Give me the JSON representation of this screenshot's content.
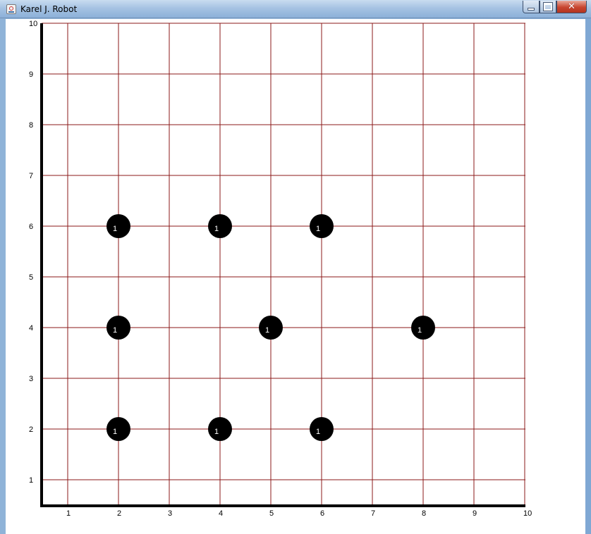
{
  "window": {
    "title": "Karel J. Robot",
    "controls": {
      "minimize": "minimize",
      "maximize": "maximize",
      "close": "close"
    }
  },
  "world": {
    "streets": 10,
    "avenues": 10,
    "x_labels": [
      "1",
      "2",
      "3",
      "4",
      "5",
      "6",
      "7",
      "8",
      "9",
      "10"
    ],
    "y_labels": [
      "1",
      "2",
      "3",
      "4",
      "5",
      "6",
      "7",
      "8",
      "9",
      "10"
    ],
    "grid_color": "#8b1a1a",
    "wall_color": "#000000",
    "beepers": [
      {
        "avenue": 2,
        "street": 6,
        "count": "1"
      },
      {
        "avenue": 4,
        "street": 6,
        "count": "1"
      },
      {
        "avenue": 6,
        "street": 6,
        "count": "1"
      },
      {
        "avenue": 2,
        "street": 4,
        "count": "1"
      },
      {
        "avenue": 5,
        "street": 4,
        "count": "1"
      },
      {
        "avenue": 8,
        "street": 4,
        "count": "1"
      },
      {
        "avenue": 2,
        "street": 2,
        "count": "1"
      },
      {
        "avenue": 4,
        "street": 2,
        "count": "1"
      },
      {
        "avenue": 6,
        "street": 2,
        "count": "1"
      }
    ],
    "beeper_color": "#000000",
    "beeper_text_color": "#ffffff"
  }
}
